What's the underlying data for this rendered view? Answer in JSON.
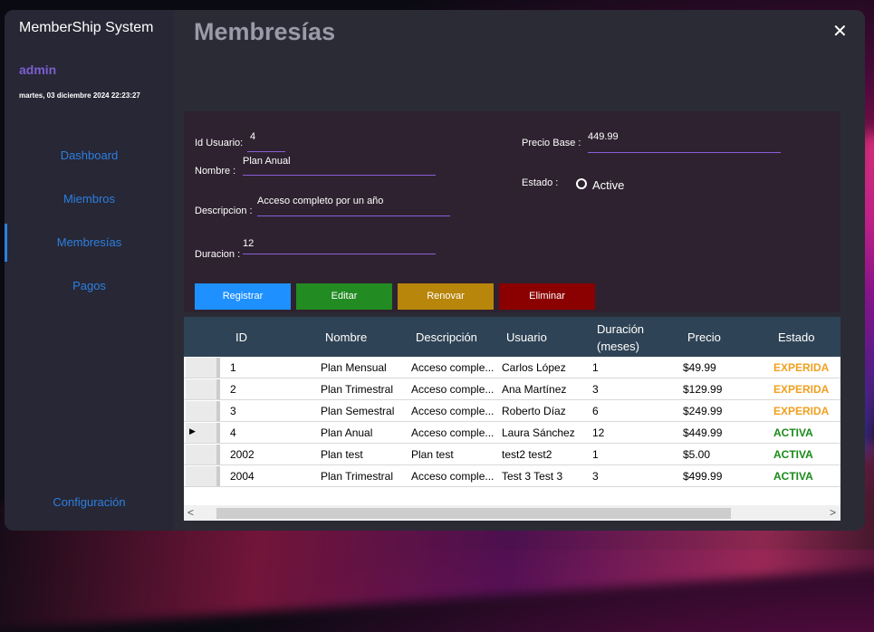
{
  "app_title": "MemberShip System",
  "user": "admin",
  "datetime": "martes, 03 diciembre 2024 22:23:27",
  "nav": [
    "Dashboard",
    "Miembros",
    "Membresías",
    "Pagos"
  ],
  "config": "Configuración",
  "page_title": "Membresías",
  "close_glyph": "✕",
  "form": {
    "id_label": "Id Usuario:",
    "id_value": "4",
    "nombre_label": "Nombre :",
    "nombre_value": "Plan Anual",
    "descripcion_label": "Descripcion :",
    "descripcion_value": "Acceso completo por un año",
    "duracion_label": "Duracion :",
    "duracion_value": "12",
    "precio_label": "Precio Base :",
    "precio_value": "449.99",
    "estado_label": "Estado :",
    "estado_option": "Active"
  },
  "buttons": {
    "registrar": "Registrar",
    "editar": "Editar",
    "renovar": "Renovar",
    "eliminar": "Eliminar",
    "colors": {
      "registrar": "#1e90ff",
      "editar": "#228b22",
      "renovar": "#b8860b",
      "eliminar": "#8b0000"
    }
  },
  "table": {
    "headers": [
      "ID",
      "Nombre",
      "Descripción",
      "Usuario",
      "Duración",
      "(meses)",
      "Precio",
      "Estado"
    ],
    "rows": [
      {
        "id": "1",
        "nombre": "Plan Mensual",
        "desc": "Acceso comple...",
        "usuario": "Carlos López",
        "dur": "1",
        "precio": "$49.99",
        "estado": "EXPERIDA",
        "color": "#f0a020"
      },
      {
        "id": "2",
        "nombre": "Plan Trimestral",
        "desc": "Acceso comple...",
        "usuario": "Ana Martínez",
        "dur": "3",
        "precio": "$129.99",
        "estado": "EXPERIDA",
        "color": "#f0a020"
      },
      {
        "id": "3",
        "nombre": "Plan Semestral",
        "desc": "Acceso comple...",
        "usuario": "Roberto Díaz",
        "dur": "6",
        "precio": "$249.99",
        "estado": "EXPERIDA",
        "color": "#f0a020"
      },
      {
        "id": "4",
        "nombre": "Plan Anual",
        "desc": "Acceso comple...",
        "usuario": "Laura Sánchez",
        "dur": "12",
        "precio": "$449.99",
        "estado": "ACTIVA",
        "color": "#1a8a1a"
      },
      {
        "id": "2002",
        "nombre": "Plan test",
        "desc": "Plan test",
        "usuario": "test2 test2",
        "dur": "1",
        "precio": "$5.00",
        "estado": "ACTIVA",
        "color": "#1a8a1a"
      },
      {
        "id": "2004",
        "nombre": "Plan Trimestral",
        "desc": "Acceso comple...",
        "usuario": "Test 3 Test 3",
        "dur": "3",
        "precio": "$499.99",
        "estado": "ACTIVA",
        "color": "#1a8a1a"
      }
    ],
    "current_row_marker": "▶",
    "scroll_left": "<",
    "scroll_right": ">"
  }
}
